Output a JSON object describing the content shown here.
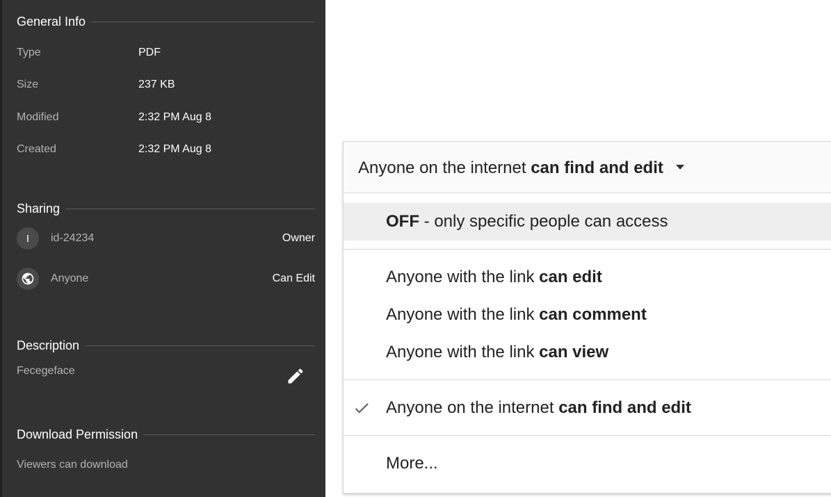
{
  "general_info": {
    "title": "General Info",
    "rows": [
      {
        "label": "Type",
        "value": "PDF"
      },
      {
        "label": "Size",
        "value": "237 KB"
      },
      {
        "label": "Modified",
        "value": "2:32 PM Aug 8"
      },
      {
        "label": "Created",
        "value": "2:32 PM Aug 8"
      }
    ]
  },
  "sharing": {
    "title": "Sharing",
    "entries": [
      {
        "avatar": "I",
        "name": "id-24234",
        "role": "Owner"
      },
      {
        "avatar_icon": "globe-icon",
        "name": "Anyone",
        "role": "Can Edit"
      }
    ]
  },
  "description": {
    "title": "Description",
    "text": "Fecegeface",
    "edit_icon": "pencil-icon"
  },
  "download_permission": {
    "title": "Download Permission",
    "text": "Viewers can download"
  },
  "dropdown": {
    "current": {
      "prefix": "Anyone on the internet ",
      "bold": "can find and edit"
    },
    "options": [
      {
        "bold": "OFF",
        "suffix": " - only specific people can access"
      },
      {
        "prefix": "Anyone with the link ",
        "bold": "can edit"
      },
      {
        "prefix": "Anyone with the link ",
        "bold": "can comment"
      },
      {
        "prefix": "Anyone with the link ",
        "bold": "can view"
      },
      {
        "prefix": "Anyone on the internet ",
        "bold": "can find and edit",
        "checked": true
      },
      {
        "text": "More..."
      }
    ]
  },
  "colors": {
    "panel_bg": "#323232",
    "highlight_bg": "#eeeeee",
    "divider": "#d6d6d6"
  }
}
